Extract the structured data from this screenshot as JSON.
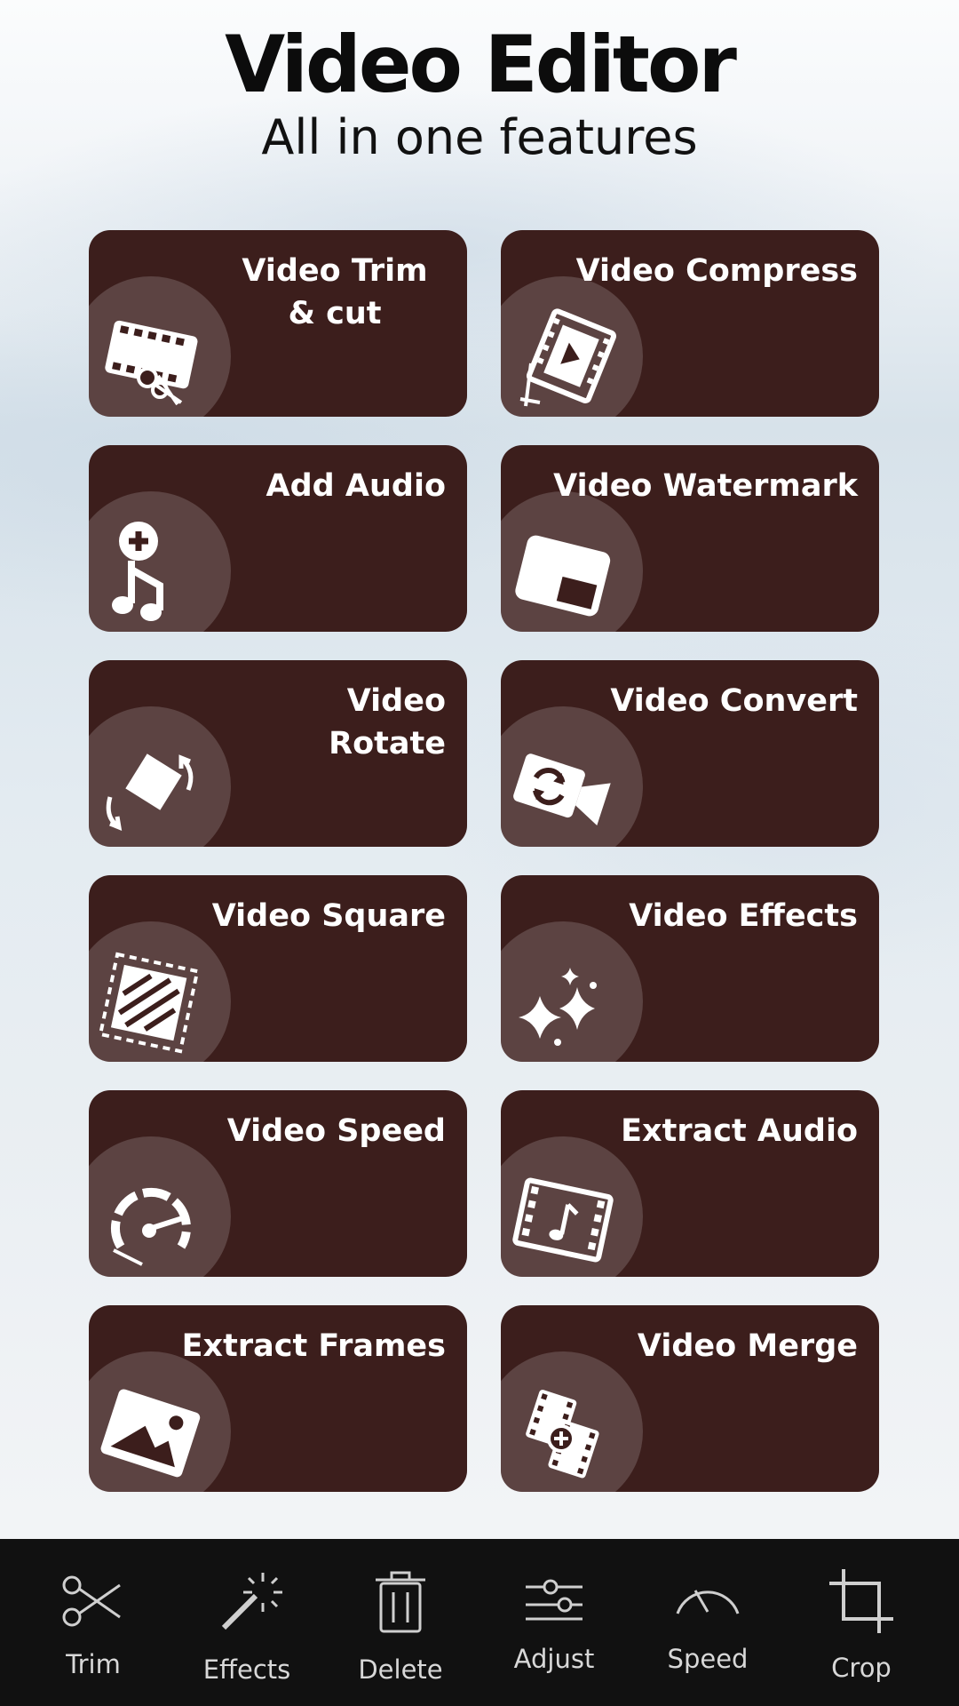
{
  "header": {
    "title": "Video Editor",
    "subtitle": "All in one features"
  },
  "colors": {
    "card_background": "#3c1e1c",
    "card_text": "#ffffff",
    "bottom_bar": "#111111"
  },
  "features": [
    {
      "label": "Video Trim & cut",
      "icon": "film-scissors-icon"
    },
    {
      "label": "Video Compress",
      "icon": "film-compress-icon"
    },
    {
      "label": "Add Audio",
      "icon": "music-add-icon"
    },
    {
      "label": "Video Watermark",
      "icon": "watermark-icon"
    },
    {
      "label": "Video Rotate",
      "icon": "rotate-icon"
    },
    {
      "label": "Video Convert",
      "icon": "camera-convert-icon"
    },
    {
      "label": "Video Square",
      "icon": "square-crop-icon"
    },
    {
      "label": "Video Effects",
      "icon": "sparkles-icon"
    },
    {
      "label": "Video Speed",
      "icon": "speedometer-icon"
    },
    {
      "label": "Extract Audio",
      "icon": "film-music-icon"
    },
    {
      "label": "Extract Frames",
      "icon": "image-icon"
    },
    {
      "label": "Video Merge",
      "icon": "film-merge-icon"
    }
  ],
  "toolbar": [
    {
      "label": "Trim",
      "icon": "scissors-icon"
    },
    {
      "label": "Effects",
      "icon": "magic-wand-icon"
    },
    {
      "label": "Delete",
      "icon": "trash-icon"
    },
    {
      "label": "Adjust",
      "icon": "sliders-icon"
    },
    {
      "label": "Speed",
      "icon": "gauge-icon"
    },
    {
      "label": "Crop",
      "icon": "crop-icon"
    }
  ]
}
